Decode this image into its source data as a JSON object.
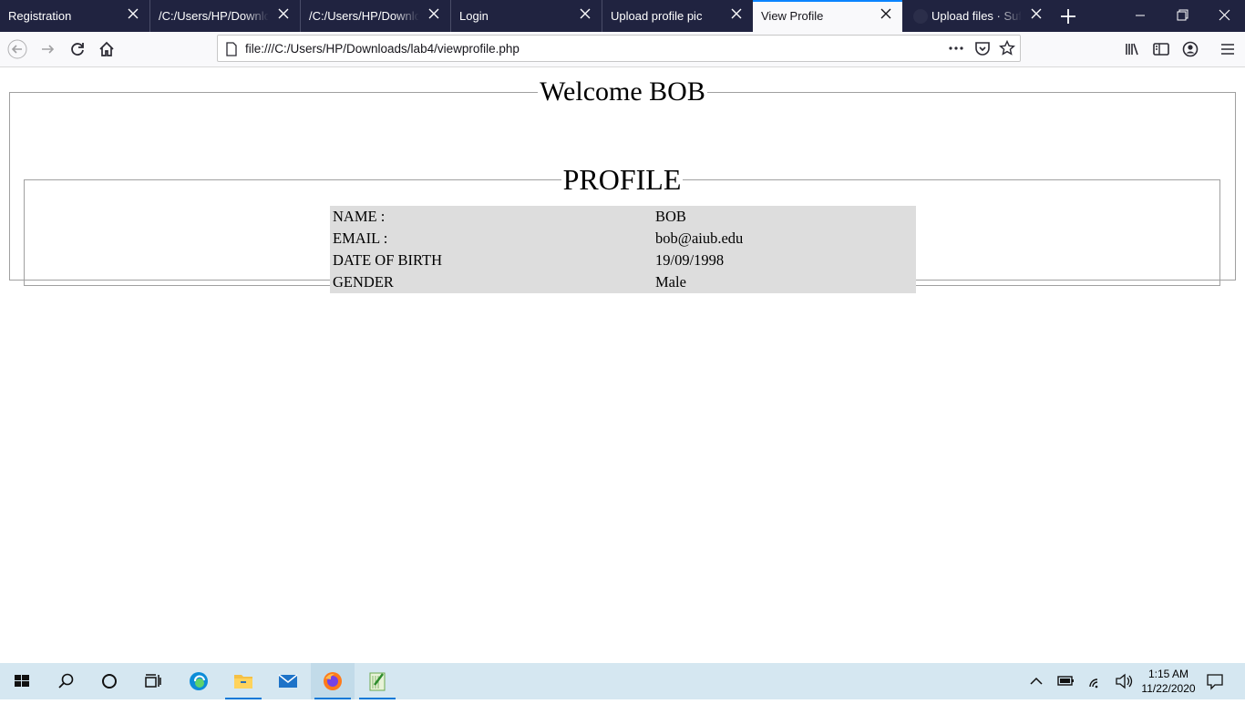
{
  "browser": {
    "tabs": [
      {
        "label": "Registration",
        "active": false
      },
      {
        "label": "/C:/Users/HP/Downloads",
        "active": false
      },
      {
        "label": "/C:/Users/HP/Downloads",
        "active": false
      },
      {
        "label": "Login",
        "active": false
      },
      {
        "label": "Upload profile pic",
        "active": false
      },
      {
        "label": "View Profile",
        "active": true
      },
      {
        "label": "Upload files · Sufimas",
        "active": false
      }
    ],
    "url": "file:///C:/Users/HP/Downloads/lab4/viewprofile.php"
  },
  "page": {
    "welcome": "Welcome BOB",
    "profile_legend": "PROFILE",
    "rows": [
      {
        "key": "NAME :",
        "value": "BOB"
      },
      {
        "key": "EMAIL :",
        "value": "bob@aiub.edu"
      },
      {
        "key": "DATE OF BIRTH",
        "value": "19/09/1998"
      },
      {
        "key": "GENDER",
        "value": "Male"
      }
    ]
  },
  "taskbar": {
    "time": "1:15 AM",
    "date": "11/22/2020"
  },
  "colors": {
    "tabbar_bg": "#202340",
    "active_tab_accent": "#0a84ff",
    "table_bg": "#dddddd",
    "taskbar_bg": "#d5e7f1"
  }
}
